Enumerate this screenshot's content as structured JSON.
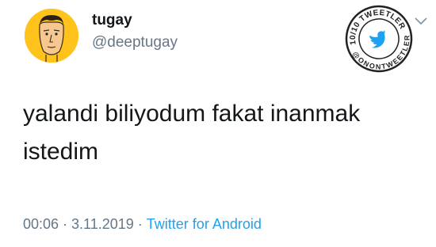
{
  "tweet": {
    "author": {
      "display_name": "tugay",
      "handle": "@deeptugay",
      "avatar_icon": "cartoon-face-avatar",
      "avatar_color": "#ffc31c"
    },
    "text": "yalandi biliyodum fakat inanmak istedim",
    "time": "00:06",
    "date": "3.11.2019",
    "separator": "·",
    "source": "Twitter for Android",
    "menu_icon": "chevron-down-icon"
  },
  "stamp": {
    "top_text": "10/10 TWEETLER",
    "bottom_text": "@ONONTWEETLER",
    "icon": "twitter-bird-icon",
    "accent_color": "#1da1f2"
  },
  "colors": {
    "text": "#14171a",
    "muted": "#657786",
    "link": "#1da1f2"
  }
}
